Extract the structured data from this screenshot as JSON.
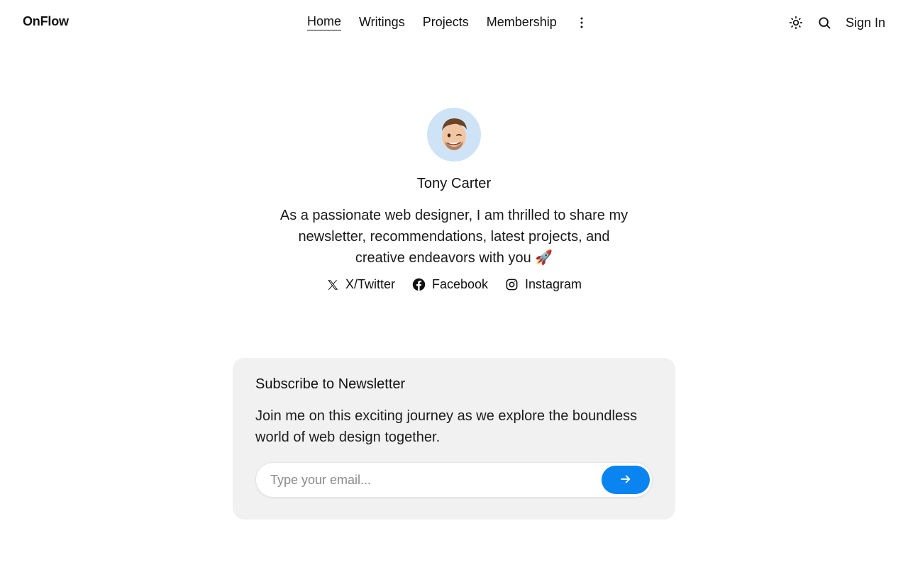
{
  "brand": "OnFlow",
  "nav": {
    "items": [
      {
        "label": "Home",
        "active": true
      },
      {
        "label": "Writings",
        "active": false
      },
      {
        "label": "Projects",
        "active": false
      },
      {
        "label": "Membership",
        "active": false
      }
    ],
    "more_icon": "more-vertical-icon"
  },
  "header_right": {
    "theme_icon": "sun-icon",
    "search_icon": "search-icon",
    "sign_in": "Sign In"
  },
  "profile": {
    "avatar_icon": "memoji-avatar",
    "name": "Tony Carter",
    "bio": "As a passionate web designer, I am thrilled to share my newsletter, recommendations, latest projects, and creative endeavors with you 🚀",
    "socials": [
      {
        "label": "X/Twitter",
        "icon": "x-twitter-icon"
      },
      {
        "label": "Facebook",
        "icon": "facebook-icon"
      },
      {
        "label": "Instagram",
        "icon": "instagram-icon"
      }
    ]
  },
  "newsletter": {
    "title": "Subscribe to Newsletter",
    "text": "Join me on this exciting journey as we explore the boundless world of web design together.",
    "placeholder": "Type your email...",
    "value": "",
    "submit_icon": "arrow-right-icon"
  },
  "colors": {
    "accent": "#0a84f0",
    "card_bg": "#f1f1f1",
    "avatar_bg": "#cfe3f7"
  }
}
